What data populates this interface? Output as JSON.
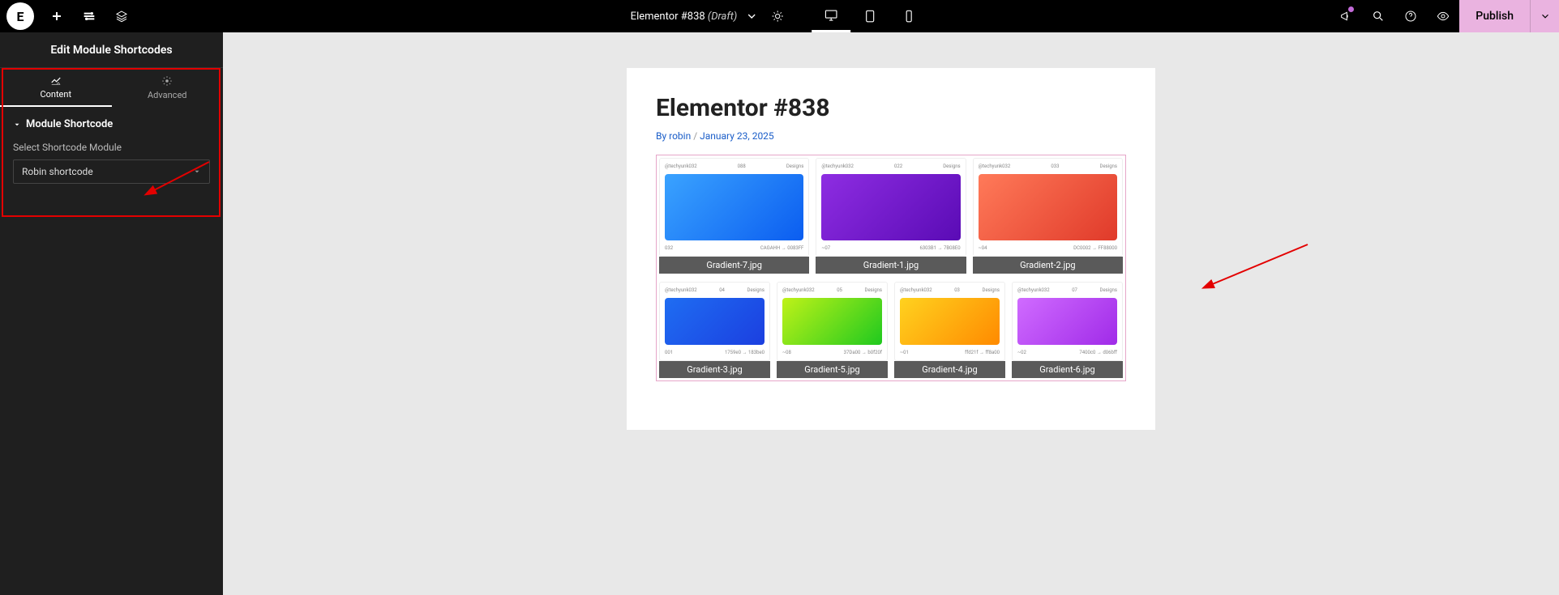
{
  "header": {
    "title": "Elementor #838",
    "draft_suffix": "(Draft)",
    "publish": "Publish"
  },
  "sidebar": {
    "panel_title": "Edit Module Shortcodes",
    "tabs": {
      "content": "Content",
      "advanced": "Advanced"
    },
    "section_title": "Module Shortcode",
    "field_label": "Select Shortcode Module",
    "dropdown_value": "Robin shortcode"
  },
  "page": {
    "h1": "Elementor #838",
    "by_prefix": "By ",
    "author_label": "robin",
    "date_label": "January 23, 2025",
    "sep": " / ",
    "cards_row1": [
      {
        "caption": "Gradient-7.jpg",
        "gradient": "grad-blue",
        "top": [
          "@techyunk032",
          "088",
          "Designs"
        ],
        "bot": [
          "032",
          "CAGAHH  →  0083FF"
        ]
      },
      {
        "caption": "Gradient-1.jpg",
        "gradient": "grad-purple",
        "top": [
          "@techyunk032",
          "022",
          "Designs"
        ],
        "bot": [
          "~07",
          "6303B1  →  7B08E0"
        ]
      },
      {
        "caption": "Gradient-2.jpg",
        "gradient": "grad-red",
        "top": [
          "@techyunk032",
          "033",
          "Designs"
        ],
        "bot": [
          "~04",
          "DC0002  →  FF88000"
        ]
      }
    ],
    "cards_row2": [
      {
        "caption": "Gradient-3.jpg",
        "gradient": "grad-blue2",
        "top": [
          "@techyunk032",
          "04",
          "Designs"
        ],
        "bot": [
          "001",
          "1759e0  →  183be0"
        ]
      },
      {
        "caption": "Gradient-5.jpg",
        "gradient": "grad-green",
        "top": [
          "@techyunk032",
          "05",
          "Designs"
        ],
        "bot": [
          "~08",
          "37Da00  →  b0f20f"
        ]
      },
      {
        "caption": "Gradient-4.jpg",
        "gradient": "grad-orange",
        "top": [
          "@techyunk032",
          "03",
          "Designs"
        ],
        "bot": [
          "~01",
          "ffd21f  →  ff8a00"
        ]
      },
      {
        "caption": "Gradient-6.jpg",
        "gradient": "grad-magenta",
        "top": [
          "@techyunk032",
          "07",
          "Designs"
        ],
        "bot": [
          "~02",
          "7400c0  →  d06bff"
        ]
      }
    ]
  }
}
